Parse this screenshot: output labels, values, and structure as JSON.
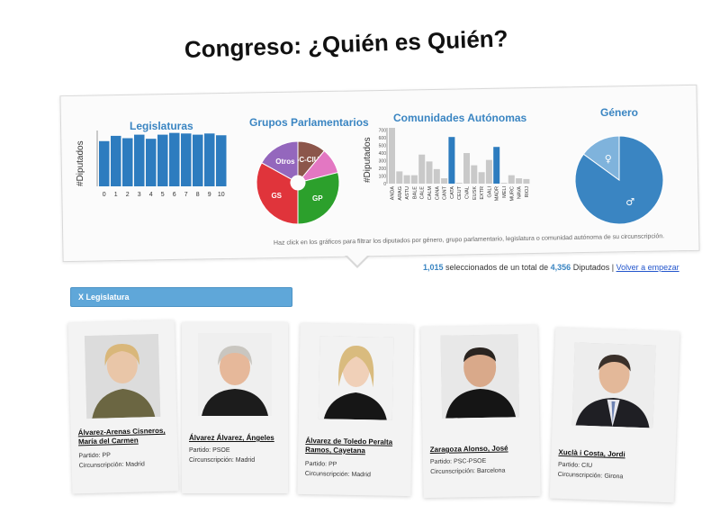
{
  "page": {
    "title": "Congreso: ¿Quién es Quién?"
  },
  "dashboard": {
    "hint": "Haz click en los gráficos para filtrar los diputados por género, grupo parlamentario, legislatura o comunidad autónoma de su circunscripción."
  },
  "summary": {
    "selected": "1,015",
    "selected_text": "seleccionados de un total de",
    "total": "4,356",
    "total_text": "Diputados |",
    "reset_link": "Volver a empezar"
  },
  "legislature_banner": "X Legislatura",
  "colors": {
    "accent": "#3a85c2",
    "bar_blue": "#2d7cbf",
    "bar_gray": "#c9c9c9",
    "pie_dark": "#3a85c2",
    "pie_light": "#7fb3dc",
    "gs": "#e0343b",
    "gp": "#2ca02c",
    "otros": "#9467bd",
    "gcciu": "#8c564b",
    "pink": "#e377c2"
  },
  "chart_data": [
    {
      "type": "bar",
      "title": "Legislaturas",
      "ylabel": "#Diputados",
      "xlabel": "",
      "categories": [
        "0",
        "1",
        "2",
        "3",
        "4",
        "5",
        "6",
        "7",
        "8",
        "9",
        "10"
      ],
      "values": [
        385,
        430,
        410,
        440,
        405,
        440,
        455,
        450,
        440,
        450,
        435
      ],
      "ylim": [
        0,
        460
      ]
    },
    {
      "type": "pie",
      "title": "Grupos Parlamentarios",
      "labels": [
        "GC-CIU",
        "GP",
        "GS",
        "Otros",
        ""
      ],
      "values": [
        11,
        29,
        33,
        17,
        10
      ]
    },
    {
      "type": "bar",
      "title": "Comunidades Autónomas",
      "ylabel": "#Diputados",
      "xlabel": "",
      "categories": [
        "ANDA",
        "ARAG",
        "ASTU",
        "BALE",
        "CALE",
        "CALM",
        "CANA",
        "CANT",
        "CATA",
        "CEUT",
        "CVAL",
        "EUSK",
        "EXTR",
        "GALI",
        "MADR",
        "MELI",
        "MURC",
        "NAVA",
        "RIOJ"
      ],
      "values": [
        730,
        160,
        110,
        110,
        380,
        290,
        190,
        70,
        610,
        10,
        400,
        240,
        150,
        310,
        480,
        10,
        110,
        70,
        60
      ],
      "highlighted": [
        "CATA",
        "MADR"
      ],
      "yticks": [
        "0",
        "100",
        "200",
        "300",
        "400",
        "500",
        "600",
        "700"
      ],
      "ylim": [
        0,
        730
      ]
    },
    {
      "type": "pie",
      "title": "Género",
      "labels": [
        "♂",
        "♀"
      ],
      "values": [
        85,
        15
      ]
    }
  ],
  "cards": [
    {
      "name": "Álvarez-Arenas Cisneros, María del Carmen",
      "party_label": "Partido:",
      "party": "PP",
      "constituency_label": "Circunscripción:",
      "constituency": "Madrid"
    },
    {
      "name": "Álvarez Álvarez, Ángeles",
      "party_label": "Partido:",
      "party": "PSOE",
      "constituency_label": "Circunscripción:",
      "constituency": "Madrid"
    },
    {
      "name": "Álvarez de Toledo Peralta Ramos, Cayetana",
      "party_label": "Partido:",
      "party": "PP",
      "constituency_label": "Circunscripción:",
      "constituency": "Madrid"
    },
    {
      "name": "Zaragoza Alonso, José",
      "party_label": "Partido:",
      "party": "PSC-PSOE",
      "constituency_label": "Circunscripción:",
      "constituency": "Barcelona"
    },
    {
      "name": "Xuclà i Costa, Jordi",
      "party_label": "Partido:",
      "party": "CIU",
      "constituency_label": "Circunscripción:",
      "constituency": "Girona"
    }
  ]
}
